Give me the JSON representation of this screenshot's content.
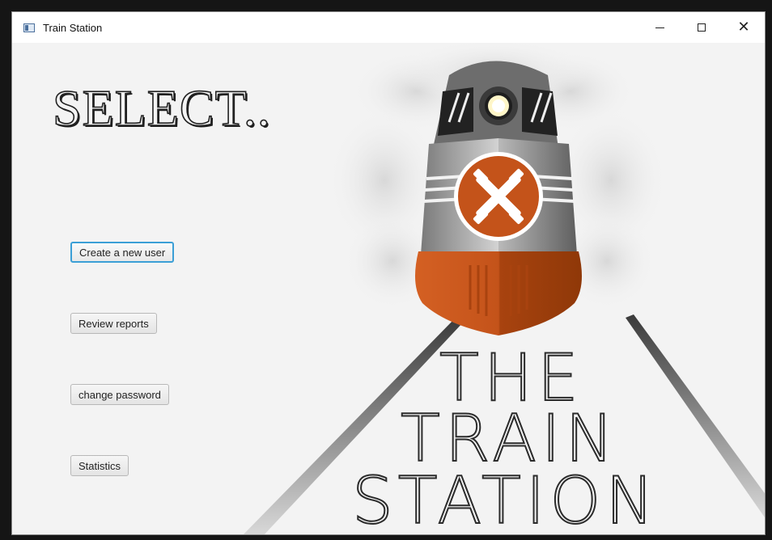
{
  "window": {
    "title": "Train Station",
    "controls": {
      "minimize_icon": "minimize-icon",
      "maximize_icon": "maximize-icon",
      "close_icon": "close-icon"
    }
  },
  "main": {
    "heading": "SELECT..",
    "buttons": [
      {
        "label": "Create a new user",
        "focused": true
      },
      {
        "label": "Review reports",
        "focused": false
      },
      {
        "label": "change password",
        "focused": false
      },
      {
        "label": "Statistics",
        "focused": false
      }
    ]
  },
  "logo": {
    "line1": "THE",
    "line2": "TRAIN",
    "line3": "STATION",
    "colors": {
      "accent": "#c4531a",
      "body": "#9a9a9a",
      "dark": "#2b2b2b"
    }
  }
}
